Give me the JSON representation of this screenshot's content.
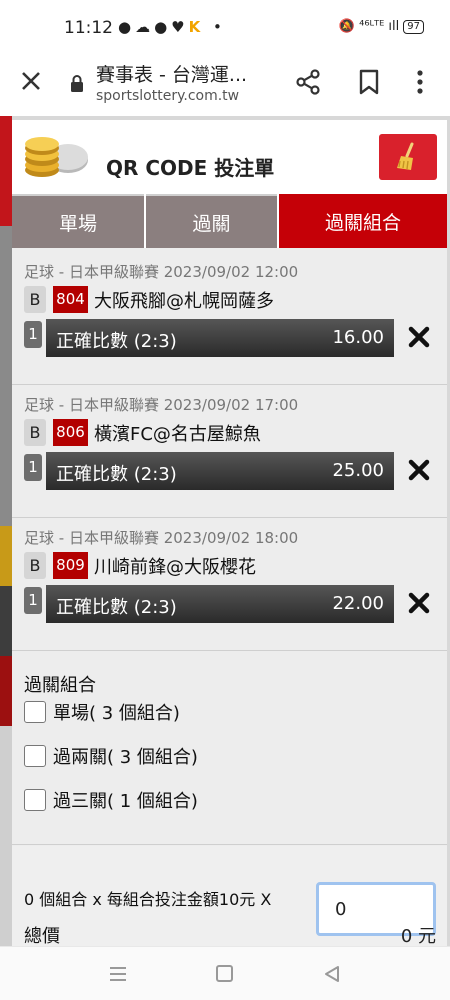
{
  "status_bar": {
    "time": "11:12",
    "left_icons": "●☁●♥",
    "k_icon": "K",
    "dot": "•",
    "right_icons": "🔕 ⁴⁶ᴸᵀᴱ ıll",
    "battery": "97"
  },
  "browser": {
    "title": "賽事表 - 台灣運...",
    "url": "sportslottery.com.tw",
    "icons": [
      "close-icon",
      "lock-icon",
      "share-icon",
      "bookmark-icon",
      "more-icon"
    ]
  },
  "panel": {
    "title": "QR CODE 投注單",
    "clear_icon": "broom-icon",
    "tabs": [
      {
        "label": "單場",
        "active": false
      },
      {
        "label": "過關",
        "active": false
      },
      {
        "label": "過關組合",
        "active": true
      }
    ]
  },
  "bets": [
    {
      "meta": "足球 - 日本甲級聯賽 2023/09/02 12:00",
      "type": "B",
      "code": "804",
      "match": "大阪飛腳@札幌岡薩多",
      "num": "1",
      "label": "正確比數 (2:3)",
      "odds": "16.00"
    },
    {
      "meta": "足球 - 日本甲級聯賽 2023/09/02 17:00",
      "type": "B",
      "code": "806",
      "match": "橫濱FC@名古屋鯨魚",
      "num": "1",
      "label": "正確比數 (2:3)",
      "odds": "25.00"
    },
    {
      "meta": "足球 - 日本甲級聯賽 2023/09/02 18:00",
      "type": "B",
      "code": "809",
      "match": "川崎前鋒@大阪櫻花",
      "num": "1",
      "label": "正確比數 (2:3)",
      "odds": "22.00"
    }
  ],
  "combo": {
    "title": "過關組合",
    "options": [
      {
        "label": "單場( 3 個組合)",
        "checked": false
      },
      {
        "label": "過兩關( 3 個組合)",
        "checked": false
      },
      {
        "label": "過三關( 1 個組合)",
        "checked": false
      }
    ]
  },
  "amount": {
    "text": "0 個組合 x 每組合投注金額10元 X",
    "value": "0"
  },
  "total": {
    "label": "總價",
    "value": "0 元"
  },
  "colors": {
    "accent_red": "#c50007",
    "tab_inactive": "#8b7f7f",
    "panel_bg": "#ededed"
  }
}
